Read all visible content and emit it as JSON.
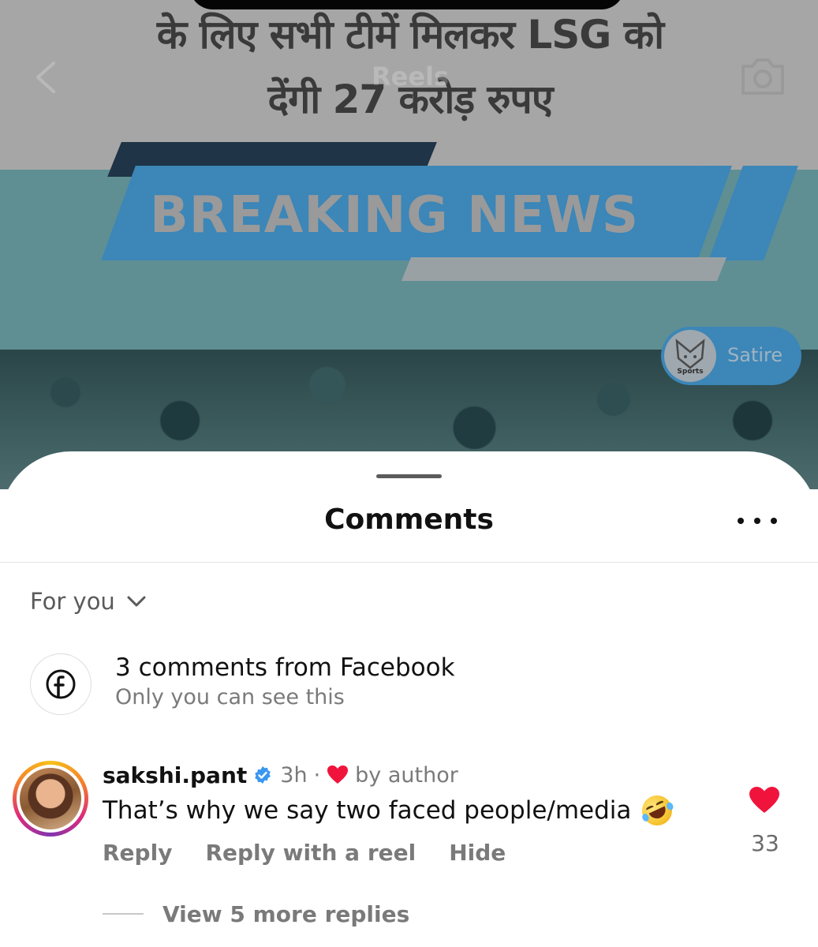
{
  "reel": {
    "headline_line1": "के लिए सभी टीमें मिलकर LSG को",
    "headline_line2": "देंगी 27 करोड़ रुपए",
    "page_title": "Reels",
    "banner_text": "BREAKING NEWS",
    "badge_logo_text": "Sports",
    "badge_label": "Satire",
    "icons": {
      "back": "chevron-left-icon",
      "camera": "camera-icon"
    }
  },
  "sheet": {
    "title": "Comments",
    "more_icon": "more-horizontal-icon",
    "filter": {
      "label": "For you",
      "icon": "chevron-down-icon"
    }
  },
  "facebook_notice": {
    "icon": "facebook-icon",
    "title": "3 comments from Facebook",
    "subtitle": "Only you can see this"
  },
  "comment": {
    "username": "sakshi.pant",
    "verified_icon": "verified-badge-icon",
    "time": "3h",
    "separator": "·",
    "author_heart_icon": "heart-icon",
    "liked_by": "by author",
    "text": "That’s why we say two faced people/media",
    "emoji": "rolling-on-floor-laughing-emoji",
    "actions": {
      "reply": "Reply",
      "reply_reel": "Reply with a reel",
      "hide": "Hide"
    },
    "like_count": "33",
    "view_replies": "View 5 more replies"
  },
  "colors": {
    "like_red": "#f0143c",
    "verified_blue": "#3897f0",
    "muted_text": "#7a7a7a",
    "banner_blue": "#3c86b8"
  }
}
